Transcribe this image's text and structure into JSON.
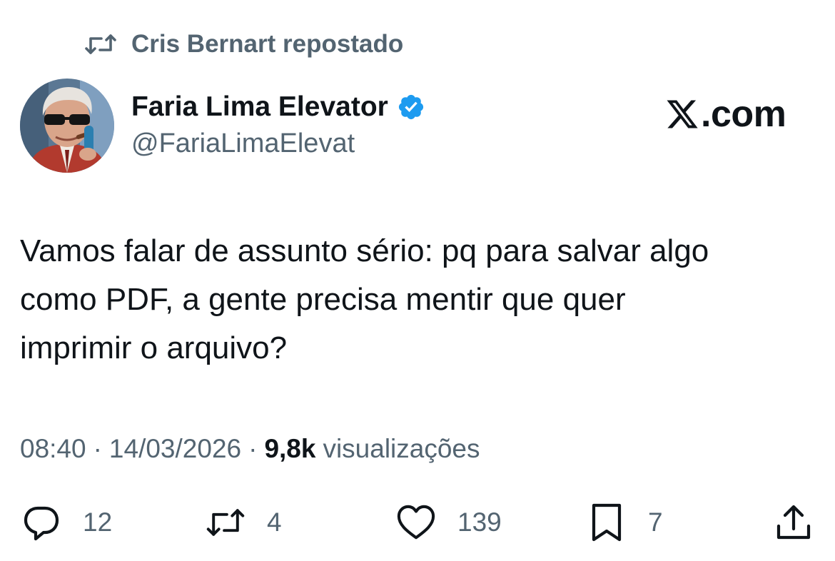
{
  "repost_banner": {
    "text": "Cris Bernart repostado",
    "icon": "repost-icon"
  },
  "author": {
    "display_name": "Faria Lima Elevator",
    "handle": "@FariaLimaElevat",
    "verified": true,
    "verified_color": "#1d9bf0",
    "avatar_icon": "avatar-photo"
  },
  "site": {
    "domain": ".com",
    "logo_icon": "x-logo-icon"
  },
  "tweet": {
    "lines": [
      "Vamos falar de assunto sério: pq para salvar algo",
      "como PDF, a gente precisa mentir que quer",
      "imprimir o arquivo?"
    ]
  },
  "meta": {
    "time": "08:40",
    "separator": "·",
    "date": "14/03/2026",
    "views_count": "9,8k",
    "views_label": "visualizações"
  },
  "actions": {
    "replies": "12",
    "reposts": "4",
    "likes": "139",
    "bookmarks": "7"
  },
  "colors": {
    "text": "#0f1419",
    "secondary": "#536471",
    "accent": "#1d9bf0"
  }
}
